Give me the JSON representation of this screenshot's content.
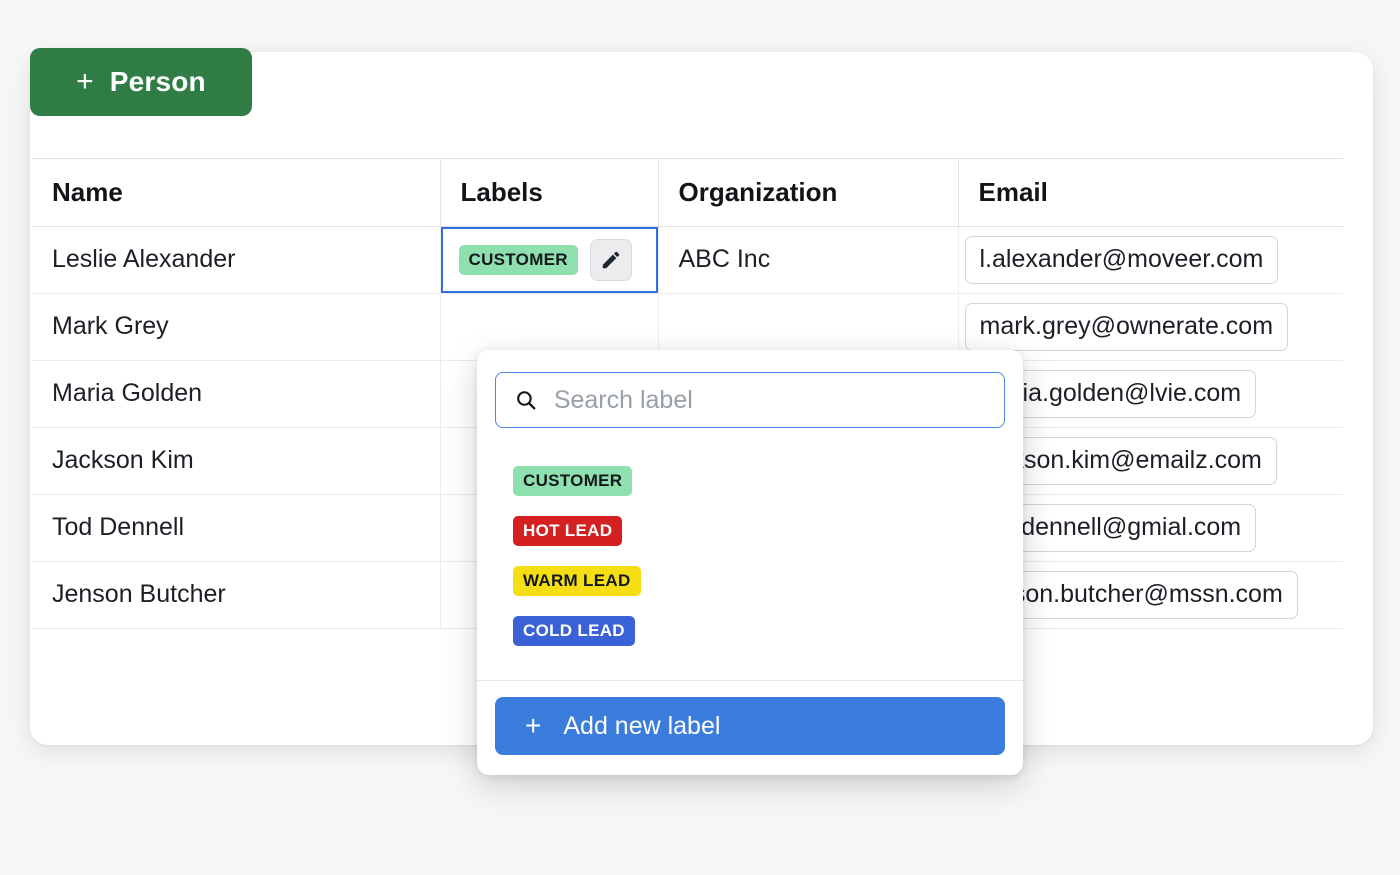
{
  "toolbar": {
    "add_person_label": "Person",
    "add_person_plus": "+",
    "add_person_color": "#2f7d45"
  },
  "table": {
    "columns": [
      "Name",
      "Labels",
      "Organization",
      "Email"
    ],
    "rows": [
      {
        "name": "Leslie Alexander",
        "label": "CUSTOMER",
        "organization": "ABC Inc",
        "email": "l.alexander@moveer.com"
      },
      {
        "name": "Mark Grey",
        "label": "",
        "organization": "",
        "email": "mark.grey@ownerate.com"
      },
      {
        "name": "Maria Golden",
        "label": "",
        "organization": "",
        "email": "maria.golden@lvie.com"
      },
      {
        "name": "Jackson Kim",
        "label": "",
        "organization": "",
        "email": "jackson.kim@emailz.com"
      },
      {
        "name": "Tod Dennell",
        "label": "",
        "organization": "",
        "email": "tod.dennell@gmial.com"
      },
      {
        "name": "Jenson Butcher",
        "label": "",
        "organization": "",
        "email": "jenson.butcher@mssn.com"
      }
    ]
  },
  "selected_cell": {
    "chip_text": "CUSTOMER",
    "chip_bg": "#8ee0ae",
    "chip_fg": "#14181d",
    "edit_icon": "pencil-icon",
    "focus_border_color": "#2f6fe4"
  },
  "label_popover": {
    "search": {
      "placeholder": "Search label",
      "value": "",
      "icon": "search-icon",
      "border_color": "#4a86e8"
    },
    "labels": [
      {
        "text": "CUSTOMER",
        "bg": "#8ee0ae",
        "fg": "#14181d"
      },
      {
        "text": "HOT LEAD",
        "bg": "#d42020",
        "fg": "#ffffff"
      },
      {
        "text": "WARM LEAD",
        "bg": "#f5de14",
        "fg": "#14181d"
      },
      {
        "text": "COLD LEAD",
        "bg": "#3a62d6",
        "fg": "#ffffff"
      }
    ],
    "add_button": {
      "plus": "+",
      "label": "Add new label",
      "color": "#3b7ddd"
    }
  }
}
